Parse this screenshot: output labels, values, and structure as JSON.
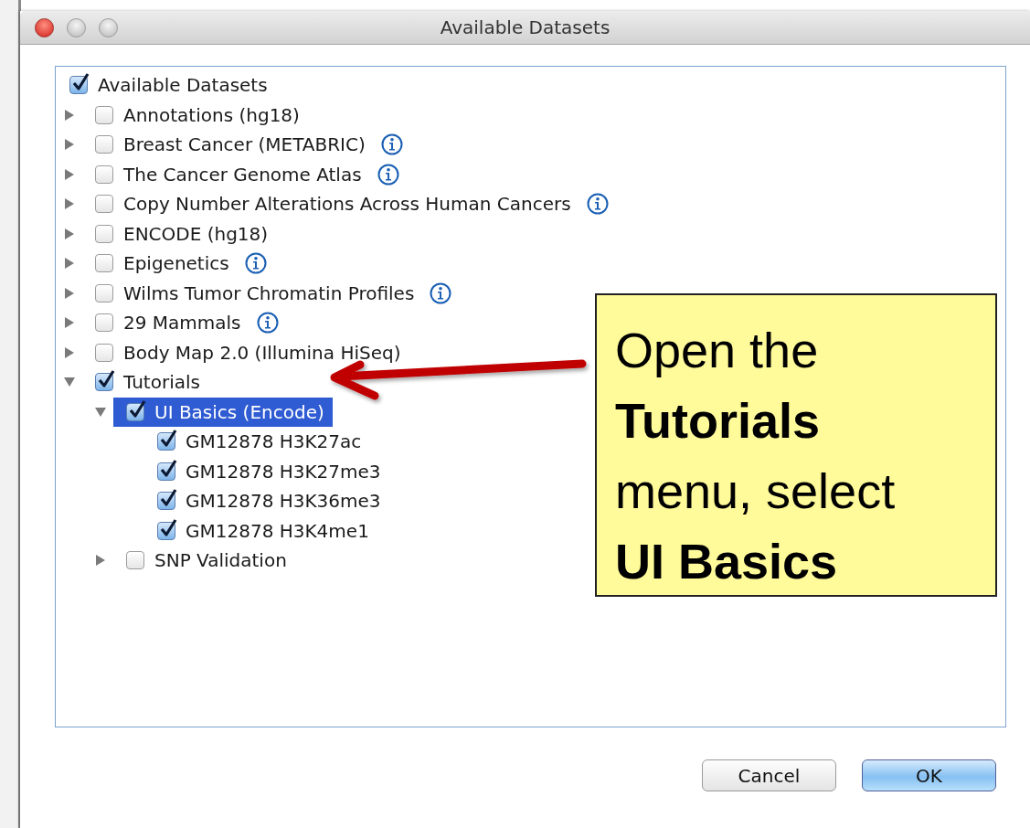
{
  "window": {
    "title": "Available Datasets"
  },
  "tree": {
    "root": {
      "label": "Available Datasets",
      "checked": true,
      "children": [
        {
          "label": "Annotations (hg18)",
          "checked": false,
          "expanded": false
        },
        {
          "label": "Breast Cancer (METABRIC)",
          "checked": false,
          "expanded": false,
          "info": true
        },
        {
          "label": "The Cancer Genome Atlas",
          "checked": false,
          "expanded": false,
          "info": true
        },
        {
          "label": "Copy Number Alterations Across Human Cancers",
          "checked": false,
          "expanded": false,
          "info": true
        },
        {
          "label": "ENCODE (hg18)",
          "checked": false,
          "expanded": false
        },
        {
          "label": "Epigenetics",
          "checked": false,
          "expanded": false,
          "info": true
        },
        {
          "label": "Wilms Tumor Chromatin Profiles",
          "checked": false,
          "expanded": false,
          "info": true
        },
        {
          "label": "29 Mammals",
          "checked": false,
          "expanded": false,
          "info": true
        },
        {
          "label": "Body Map 2.0 (Illumina HiSeq)",
          "checked": false,
          "expanded": false
        },
        {
          "label": "Tutorials",
          "checked": true,
          "expanded": true,
          "children": [
            {
              "label": "UI Basics (Encode)",
              "checked": true,
              "expanded": true,
              "selected": true,
              "children": [
                {
                  "label": "GM12878 H3K27ac",
                  "checked": true
                },
                {
                  "label": "GM12878 H3K27me3",
                  "checked": true
                },
                {
                  "label": "GM12878 H3K36me3",
                  "checked": true
                },
                {
                  "label": "GM12878 H3K4me1",
                  "checked": true
                }
              ]
            },
            {
              "label": "SNP Validation",
              "checked": false,
              "expanded": false,
              "selected": false
            }
          ]
        }
      ]
    }
  },
  "buttons": [
    {
      "label": "Cancel",
      "kind": "secondary"
    },
    {
      "label": "OK",
      "kind": "default"
    }
  ],
  "callout": {
    "lines": [
      "Open the",
      "**Tutorials**",
      "menu, select",
      "**UI Basics**"
    ]
  }
}
